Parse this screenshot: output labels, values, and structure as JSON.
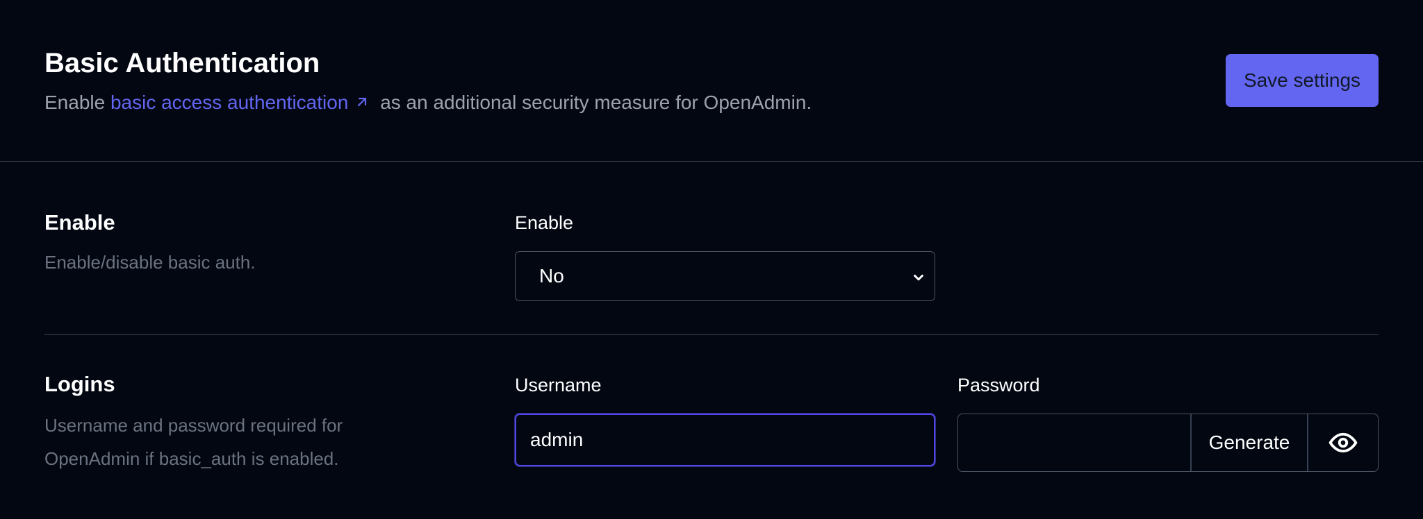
{
  "header": {
    "title": "Basic Authentication",
    "desc_prefix": "Enable",
    "desc_link": "basic access authentication",
    "desc_suffix": "as an additional security measure for OpenAdmin.",
    "save_label": "Save settings",
    "link_icon": "external-link-icon"
  },
  "enable_section": {
    "title": "Enable",
    "desc": "Enable/disable basic auth.",
    "field_label": "Enable",
    "selected": "No"
  },
  "logins_section": {
    "title": "Logins",
    "desc": "Username and password required for OpenAdmin if basic_auth is enabled.",
    "username_label": "Username",
    "username_value": "admin",
    "password_label": "Password",
    "password_value": "",
    "generate_label": "Generate",
    "eye_icon": "eye-icon"
  },
  "colors": {
    "background": "#030712",
    "accent": "#6366f1",
    "muted_text": "#9ca3af",
    "border": "#374151"
  }
}
